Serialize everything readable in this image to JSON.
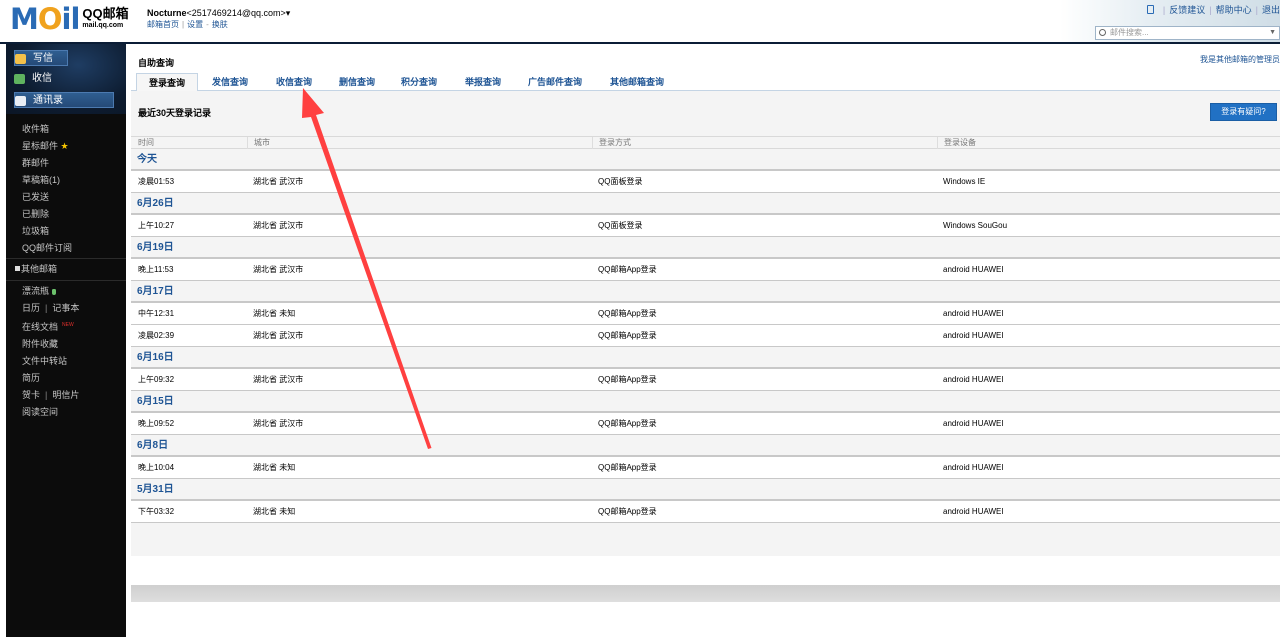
{
  "header": {
    "logo_text_main": "M",
    "logo_text_o": "O",
    "logo_text_il": "il",
    "logo_cn": "QQ邮箱",
    "logo_domain": "mail.qq.com",
    "user_name": "Nocturne",
    "user_email": "<2517469214@qq.com>",
    "user_dropdown": "▾",
    "link_home": "邮箱首页",
    "link_settings": "设置",
    "link_skin": "换肤",
    "top_links": [
      "反馈建议",
      "帮助中心",
      "退出"
    ],
    "search_placeholder": "邮件搜索..."
  },
  "sidebar": {
    "compose": "写信",
    "inbox": "收信",
    "contacts": "通讯录",
    "folders": [
      "收件箱",
      "星标邮件",
      "群邮件",
      "草稿箱(1)",
      "已发送",
      "已删除",
      "垃圾箱",
      "QQ邮件订阅"
    ],
    "other_mailbox": "其他邮箱",
    "tools": {
      "drift": "漂流瓶",
      "calendar": "日历",
      "notepad": "记事本",
      "docs": "在线文档",
      "new_badge": "NEW",
      "attachments": "附件收藏",
      "transfer": "文件中转站",
      "resume": "简历",
      "card": "贺卡",
      "postcard": "明信片",
      "reading": "阅读空间"
    }
  },
  "main": {
    "page_title": "自助查询",
    "admin_link": "我是其他邮箱的管理员",
    "tabs": [
      "登录查询",
      "发信查询",
      "收信查询",
      "删信查询",
      "积分查询",
      "举报查询",
      "广告邮件查询",
      "其他邮箱查询"
    ],
    "active_tab": "登录查询",
    "section_title": "最近30天登录记录",
    "help_button": "登录有疑问?",
    "columns": [
      "时间",
      "城市",
      "登录方式",
      "登录设备"
    ],
    "groups": [
      {
        "date": "今天",
        "rows": [
          [
            "凌晨01:53",
            "湖北省 武汉市",
            "QQ面板登录",
            "Windows IE"
          ]
        ]
      },
      {
        "date": "6月26日",
        "rows": [
          [
            "上午10:27",
            "湖北省 武汉市",
            "QQ面板登录",
            "Windows SouGou"
          ]
        ]
      },
      {
        "date": "6月19日",
        "rows": [
          [
            "晚上11:53",
            "湖北省 武汉市",
            "QQ邮箱App登录",
            "android HUAWEI"
          ]
        ]
      },
      {
        "date": "6月17日",
        "rows": [
          [
            "中午12:31",
            "湖北省 未知",
            "QQ邮箱App登录",
            "android HUAWEI"
          ],
          [
            "凌晨02:39",
            "湖北省 武汉市",
            "QQ邮箱App登录",
            "android HUAWEI"
          ]
        ]
      },
      {
        "date": "6月16日",
        "rows": [
          [
            "上午09:32",
            "湖北省 武汉市",
            "QQ邮箱App登录",
            "android HUAWEI"
          ]
        ]
      },
      {
        "date": "6月15日",
        "rows": [
          [
            "晚上09:52",
            "湖北省 武汉市",
            "QQ邮箱App登录",
            "android HUAWEI"
          ]
        ]
      },
      {
        "date": "6月8日",
        "rows": [
          [
            "晚上10:04",
            "湖北省 未知",
            "QQ邮箱App登录",
            "android HUAWEI"
          ]
        ]
      },
      {
        "date": "5月31日",
        "rows": [
          [
            "下午03:32",
            "湖北省 未知",
            "QQ邮箱App登录",
            "android HUAWEI"
          ]
        ]
      }
    ]
  },
  "annotation": {
    "color": "#ff4040"
  },
  "colors": {
    "link": "#1e5494",
    "sidebar_bg": "#0c0c0c",
    "button": "#2171c4"
  }
}
